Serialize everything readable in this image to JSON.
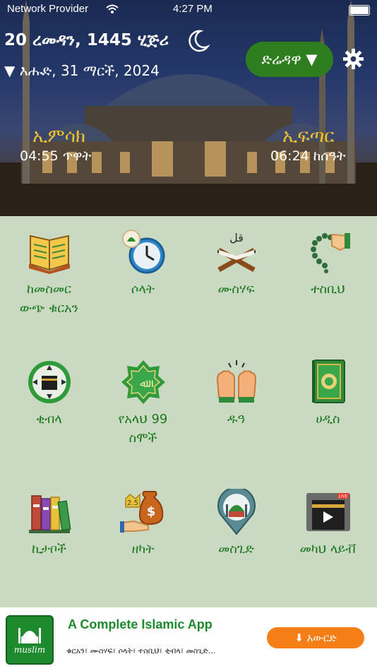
{
  "status_bar": {
    "provider": "Network Provider",
    "time": "4:27 PM"
  },
  "header": {
    "hijri_date": "20 ረመዳን, 1445 ሂጅሪ",
    "gregorian_date": "▼ እሑድ, 31 ማርች, 2024",
    "city": "ድሬዳዋ ▼",
    "imsak_label": "ኢምሳክ",
    "imsak_time": "04:55 ጥዋት",
    "iftar_label": "ኢፍጣር",
    "iftar_time": "06:24 ከሰዓት"
  },
  "menu": [
    {
      "label": "ከመስመር\nውጭ ቁርአን",
      "icon": "quran-book-icon"
    },
    {
      "label": "ሶላት",
      "icon": "prayer-clock-icon"
    },
    {
      "label": "ሙስሃፍ",
      "icon": "mushaf-stand-icon"
    },
    {
      "label": "ተስቢህ",
      "icon": "tasbih-hand-icon"
    },
    {
      "label": "ቂብላ",
      "icon": "qibla-compass-icon"
    },
    {
      "label": "የአላህ 99\nስሞች",
      "icon": "allah-names-icon"
    },
    {
      "label": "ዱዓ",
      "icon": "dua-hands-icon"
    },
    {
      "label": "ሀዲስ",
      "icon": "hadith-book-icon"
    },
    {
      "label": "ኪታቦች",
      "icon": "kitab-books-icon"
    },
    {
      "label": "ዘካት",
      "icon": "zakat-money-icon"
    },
    {
      "label": "መስጊድ",
      "icon": "mosque-pin-icon"
    },
    {
      "label": "መካህ ላይቭ",
      "icon": "makkah-live-icon"
    }
  ],
  "ad": {
    "logo_text": "muslim",
    "title": "A Complete Islamic App",
    "subtitle": "ቁርአን፣ ሙስሃፍ፣ ሶላት፣ ተስቢህ፣ ቂብላ፣ መስጊድ...",
    "download_label": "⬇  አውርድ"
  }
}
